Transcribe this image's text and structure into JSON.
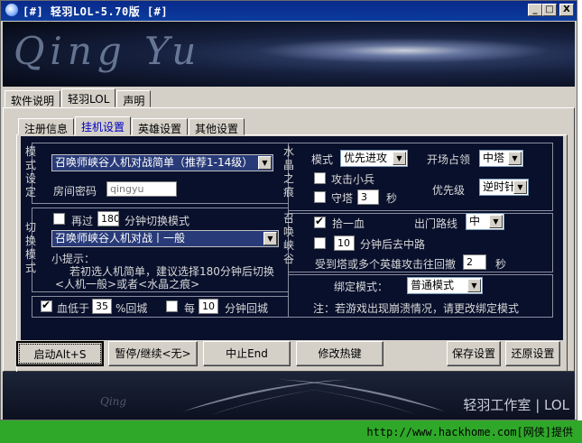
{
  "window": {
    "title": "[#] 轻羽LOL-5.70版 [#]",
    "controls": {
      "minimize": "_",
      "maximize": "□",
      "close": "X"
    }
  },
  "banner": {
    "logo_text": "Qing Yu"
  },
  "main_tabs": [
    "软件说明",
    "轻羽LOL",
    "声明"
  ],
  "sub_tabs": [
    "注册信息",
    "挂机设置",
    "英雄设置",
    "其他设置"
  ],
  "mode_setting": {
    "vertical_label": "模式设定",
    "mode_select": "召唤师峡谷人机对战简单（推荐1-14级）",
    "password_label": "房间密码",
    "password_value": "qingyu"
  },
  "switch_mode": {
    "vertical_label": "切换模式",
    "prefix": "再过",
    "minutes": "180",
    "suffix": "分钟切换模式",
    "mode_select": "召唤师峡谷人机对战丨一般",
    "tip_title": "小提示：",
    "tip_line1": "若初选人机简单，建议选择180分钟后切换",
    "tip_line2": "<人机一般>或者<水晶之痕>"
  },
  "return_city": {
    "hp_label": "血低于",
    "hp_value": "35",
    "hp_suffix": "%回城",
    "every_label": "每",
    "every_value": "10",
    "every_suffix": "分钟回城"
  },
  "crystal": {
    "vertical_label": "水晶之痕",
    "mode_label": "模式",
    "mode_value": "优先进攻",
    "open_label": "开场占领",
    "open_value": "中塔",
    "attack_minion": "攻击小兵",
    "guard_tower": "守塔",
    "guard_value": "3",
    "guard_unit": "秒",
    "priority_label": "优先级",
    "priority_value": "逆时针"
  },
  "summoner": {
    "vertical_label": "召唤峡谷",
    "pickup_hp": "拾一血",
    "lane_label": "出门路线",
    "lane_value": "中",
    "after_value": "10",
    "after_label": "分钟后去中路",
    "retreat_label": "受到塔或多个英雄攻击往回撤",
    "retreat_value": "2",
    "retreat_unit": "秒"
  },
  "binding": {
    "label": "绑定模式：",
    "value": "普通模式",
    "note": "注：若游戏出现崩溃情况，请更改绑定模式"
  },
  "buttons": {
    "start": "启动Alt+S",
    "pause": "暂停/继续<无>",
    "stop": "中止End",
    "hotkey": "修改热键",
    "save": "保存设置",
    "restore": "还原设置"
  },
  "footer": {
    "brand": "轻羽工作室 | LOL",
    "faint": "Qing"
  },
  "watermark": {
    "text": "http://www.hackhome.com[网侠]提供"
  },
  "colors": {
    "title_bar": "#0b3b9e",
    "panel": "#08102c",
    "green_bar": "#2fa82a"
  }
}
